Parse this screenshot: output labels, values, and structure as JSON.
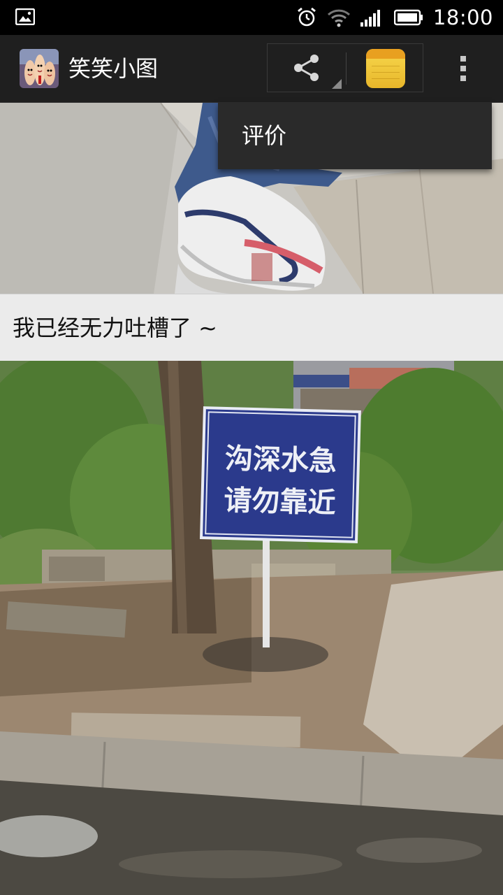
{
  "status_bar": {
    "time": "18:00"
  },
  "action_bar": {
    "app_title": "笑笑小图",
    "icons": {
      "app": "app-logo-icon",
      "share": "share-icon",
      "note": "notepad-icon",
      "overflow": "overflow-menu-icon"
    }
  },
  "popup_menu": {
    "items": [
      {
        "label": "评价"
      }
    ]
  },
  "feed": {
    "items": [
      {
        "caption": "我已经无力吐槽了 ~"
      },
      {
        "sign_text_line1": "沟深水急",
        "sign_text_line2": "请勿靠近"
      }
    ]
  },
  "colors": {
    "status_bar_bg": "#000000",
    "action_bar_bg": "#1f1f1f",
    "popup_bg": "#2a2a2a",
    "caption_bar_bg": "#ebebeb",
    "sign_blue": "#2b3a8c"
  }
}
